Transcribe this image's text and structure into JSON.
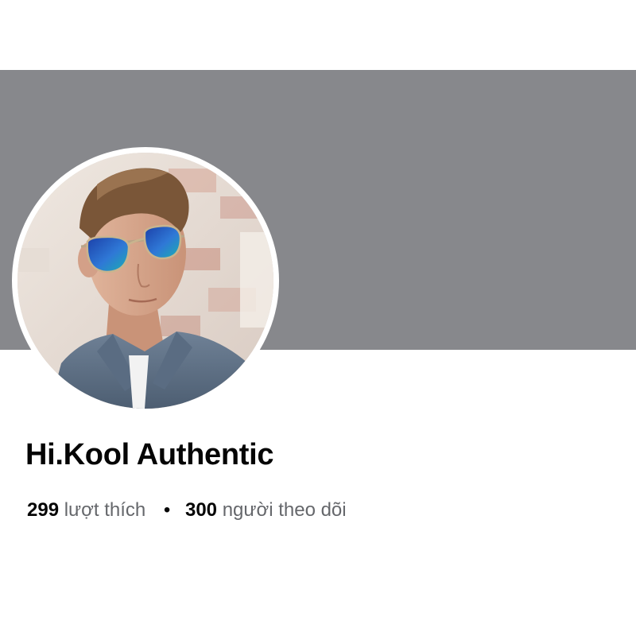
{
  "profile": {
    "name": "Hi.Kool Authentic",
    "likes_count": "299",
    "likes_label": "lượt thích",
    "separator": "•",
    "followers_count": "300",
    "followers_label": "người theo dõi"
  },
  "cover": {
    "color": "#87888c"
  },
  "avatar": {
    "subject": "profile-photo"
  },
  "colors": {
    "name_text": "#050505",
    "secondary_text": "#65676b",
    "background": "#ffffff"
  }
}
